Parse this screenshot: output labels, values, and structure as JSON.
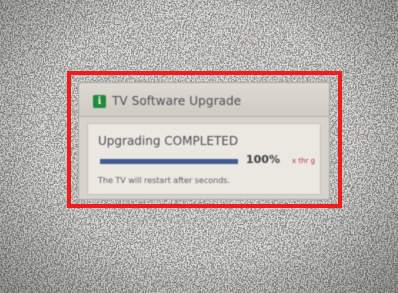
{
  "dialog": {
    "icon": "info-icon",
    "icon_glyph": "i",
    "title": "TV Software Upgrade",
    "status": "Upgrading COMPLETED",
    "progress_fraction": 1.0,
    "percent_label": "100%",
    "side_note": "x thr g",
    "restart_text": "The TV will restart after        seconds."
  },
  "colors": {
    "highlight_border": "#ee1c1c",
    "progress_fill": "#3f5b92",
    "icon_green": "#1e8a3a",
    "screen_static": "#8c8a86"
  }
}
